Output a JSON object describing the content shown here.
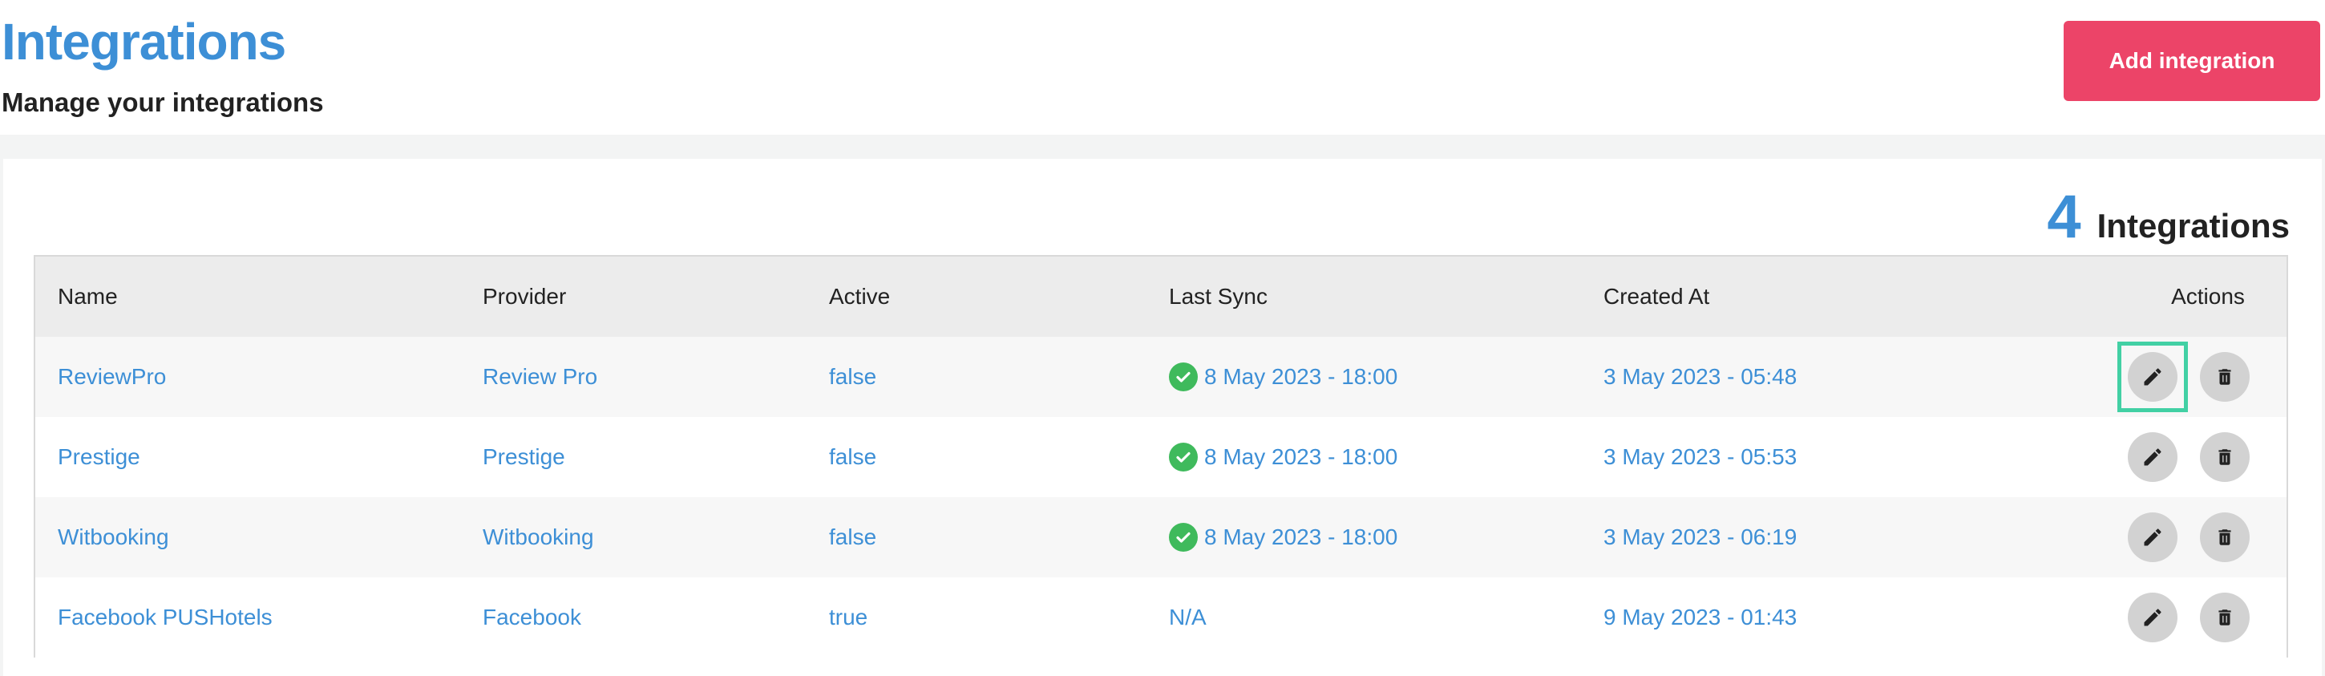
{
  "header": {
    "title": "Integrations",
    "subtitle": "Manage your integrations",
    "add_button_label": "Add integration"
  },
  "summary": {
    "count": "4",
    "label": "Integrations"
  },
  "table": {
    "columns": [
      "Name",
      "Provider",
      "Active",
      "Last Sync",
      "Created At",
      "Actions"
    ],
    "rows": [
      {
        "name": "ReviewPro",
        "provider": "Review Pro",
        "active": "false",
        "last_sync": "8 May 2023 - 18:00",
        "synced": true,
        "created_at": "3 May 2023 - 05:48"
      },
      {
        "name": "Prestige",
        "provider": "Prestige",
        "active": "false",
        "last_sync": "8 May 2023 - 18:00",
        "synced": true,
        "created_at": "3 May 2023 - 05:53"
      },
      {
        "name": "Witbooking",
        "provider": "Witbooking",
        "active": "false",
        "last_sync": "8 May 2023 - 18:00",
        "synced": true,
        "created_at": "3 May 2023 - 06:19"
      },
      {
        "name": "Facebook PUSHotels",
        "provider": "Facebook",
        "active": "true",
        "last_sync": "N/A",
        "synced": false,
        "created_at": "9 May 2023 - 01:43"
      }
    ]
  },
  "icons": {
    "sync_status": "check-circle-icon",
    "edit": "pencil-icon",
    "delete": "trash-icon"
  },
  "colors": {
    "accent": "#3d8fd6",
    "primary_button": "#ec4468",
    "success": "#3fba5c",
    "focus": "#42d0a4"
  }
}
